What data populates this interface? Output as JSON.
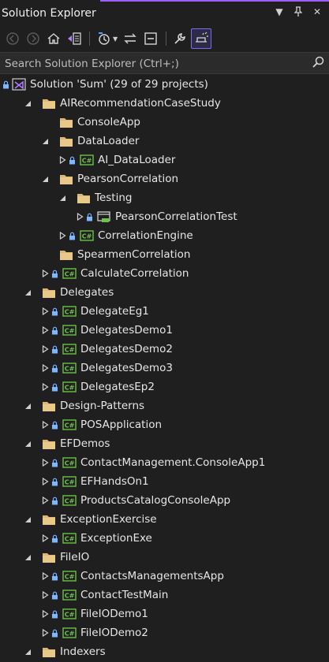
{
  "panel": {
    "title": "Solution Explorer"
  },
  "title_buttons": [
    "dropdown-icon",
    "pin-icon",
    "close-icon"
  ],
  "toolbar": {
    "buttons": [
      "back-icon",
      "forward-icon",
      "home-icon",
      "switch-views-icon",
      "pending-changes-filter-icon",
      "sync-icon",
      "collapse-all-icon",
      "properties-icon",
      "preview-selected-icon"
    ]
  },
  "search": {
    "placeholder": "Search Solution Explorer (Ctrl+;)"
  },
  "colors": {
    "folder": "#dcb67a",
    "csproj_green": "#6cc24a",
    "lock": "#7db8ff",
    "accent": "#a05cff"
  },
  "tree": [
    {
      "label": "Solution 'Sum' (29 of 29 projects)",
      "type": "solution",
      "depth": 0,
      "expander": "none",
      "lock": true
    },
    {
      "label": "AIRecommendationCaseStudy",
      "type": "folder",
      "depth": 1,
      "expander": "open",
      "lock": false
    },
    {
      "label": "ConsoleApp",
      "type": "folder",
      "depth": 2,
      "expander": "none",
      "lock": false
    },
    {
      "label": "DataLoader",
      "type": "folder",
      "depth": 2,
      "expander": "open",
      "lock": false
    },
    {
      "label": "AI_DataLoader",
      "type": "csproj",
      "depth": 3,
      "expander": "closed",
      "lock": true
    },
    {
      "label": "PearsonCorrelation",
      "type": "folder",
      "depth": 2,
      "expander": "open",
      "lock": false
    },
    {
      "label": "Testing",
      "type": "folder",
      "depth": 3,
      "expander": "open",
      "lock": false
    },
    {
      "label": "PearsonCorrelationTest",
      "type": "testproj",
      "depth": 4,
      "expander": "closed",
      "lock": true
    },
    {
      "label": "CorrelationEngine",
      "type": "csproj",
      "depth": 3,
      "expander": "closed",
      "lock": true
    },
    {
      "label": "SpearmenCorrelation",
      "type": "folder",
      "depth": 2,
      "expander": "none",
      "lock": false
    },
    {
      "label": "CalculateCorrelation",
      "type": "csproj",
      "depth": 2,
      "expander": "closed",
      "lock": true
    },
    {
      "label": "Delegates",
      "type": "folder",
      "depth": 1,
      "expander": "open",
      "lock": false
    },
    {
      "label": "DelegateEg1",
      "type": "csproj",
      "depth": 2,
      "expander": "closed",
      "lock": true
    },
    {
      "label": "DelegatesDemo1",
      "type": "csproj",
      "depth": 2,
      "expander": "closed",
      "lock": true
    },
    {
      "label": "DelegatesDemo2",
      "type": "csproj",
      "depth": 2,
      "expander": "closed",
      "lock": true
    },
    {
      "label": "DelegatesDemo3",
      "type": "csproj",
      "depth": 2,
      "expander": "closed",
      "lock": true
    },
    {
      "label": "DelegatesEp2",
      "type": "csproj",
      "depth": 2,
      "expander": "closed",
      "lock": true
    },
    {
      "label": "Design-Patterns",
      "type": "folder",
      "depth": 1,
      "expander": "open",
      "lock": false
    },
    {
      "label": "POSApplication",
      "type": "csproj",
      "depth": 2,
      "expander": "closed",
      "lock": true
    },
    {
      "label": "EFDemos",
      "type": "folder",
      "depth": 1,
      "expander": "open",
      "lock": false
    },
    {
      "label": "ContactManagement.ConsoleApp1",
      "type": "csproj",
      "depth": 2,
      "expander": "closed",
      "lock": true
    },
    {
      "label": "EFHandsOn1",
      "type": "csproj",
      "depth": 2,
      "expander": "closed",
      "lock": true
    },
    {
      "label": "ProductsCatalogConsoleApp",
      "type": "csproj",
      "depth": 2,
      "expander": "closed",
      "lock": true
    },
    {
      "label": "ExceptionExercise",
      "type": "folder",
      "depth": 1,
      "expander": "open",
      "lock": false
    },
    {
      "label": "ExceptionExe",
      "type": "csproj",
      "depth": 2,
      "expander": "closed",
      "lock": true
    },
    {
      "label": "FileIO",
      "type": "folder",
      "depth": 1,
      "expander": "open",
      "lock": false
    },
    {
      "label": "ContactsManagementsApp",
      "type": "csproj",
      "depth": 2,
      "expander": "closed",
      "lock": true
    },
    {
      "label": "ContactTestMain",
      "type": "csproj",
      "depth": 2,
      "expander": "closed",
      "lock": true
    },
    {
      "label": "FileIODemo1",
      "type": "csproj",
      "depth": 2,
      "expander": "closed",
      "lock": true
    },
    {
      "label": "FileIODemo2",
      "type": "csproj",
      "depth": 2,
      "expander": "closed",
      "lock": true
    },
    {
      "label": "Indexers",
      "type": "folder",
      "depth": 1,
      "expander": "open",
      "lock": false
    }
  ]
}
